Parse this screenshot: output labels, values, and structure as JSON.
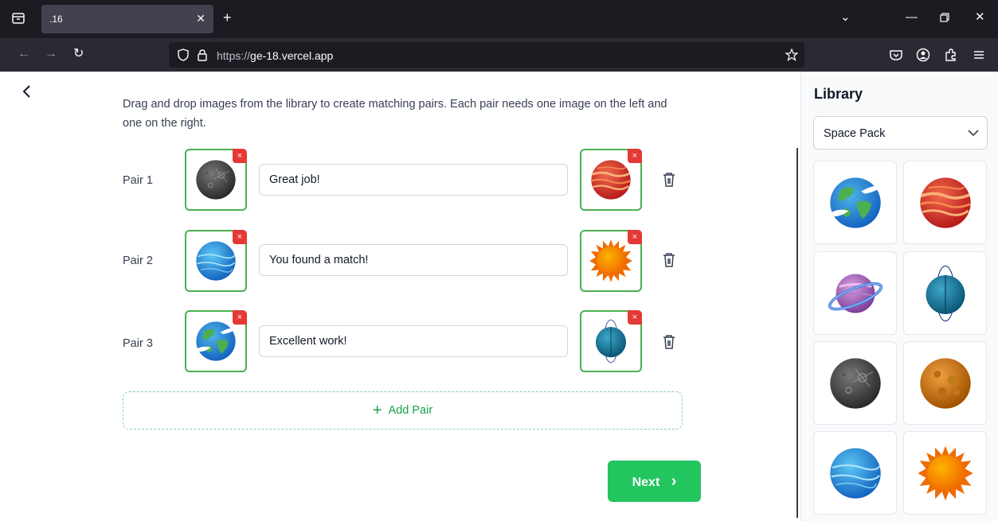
{
  "browser": {
    "tab_title": ".16",
    "url_scheme": "https://",
    "url_host": "ge-18.vercel.app"
  },
  "main": {
    "instructions": "Drag and drop images from the library to create matching pairs. Each pair needs one image on the left and one on the right.",
    "pairs": [
      {
        "label": "Pair 1",
        "left_image": "moon",
        "right_image": "jupiter",
        "message": "Great job!"
      },
      {
        "label": "Pair 2",
        "left_image": "neptune",
        "right_image": "sun",
        "message": "You found a match!"
      },
      {
        "label": "Pair 3",
        "left_image": "earth",
        "right_image": "uranus",
        "message": "Excellent work!"
      }
    ],
    "remove_symbol": "×",
    "add_pair_label": "Add Pair",
    "next_label": "Next",
    "next_chevron": "›"
  },
  "library": {
    "title": "Library",
    "selected_pack": "Space Pack",
    "items": [
      "earth",
      "jupiter",
      "saturn",
      "uranus",
      "moon",
      "mars",
      "neptune",
      "sun"
    ]
  },
  "colors": {
    "accent_green": "#22c55e",
    "slot_border": "#4caf50",
    "remove_red": "#e53935"
  }
}
